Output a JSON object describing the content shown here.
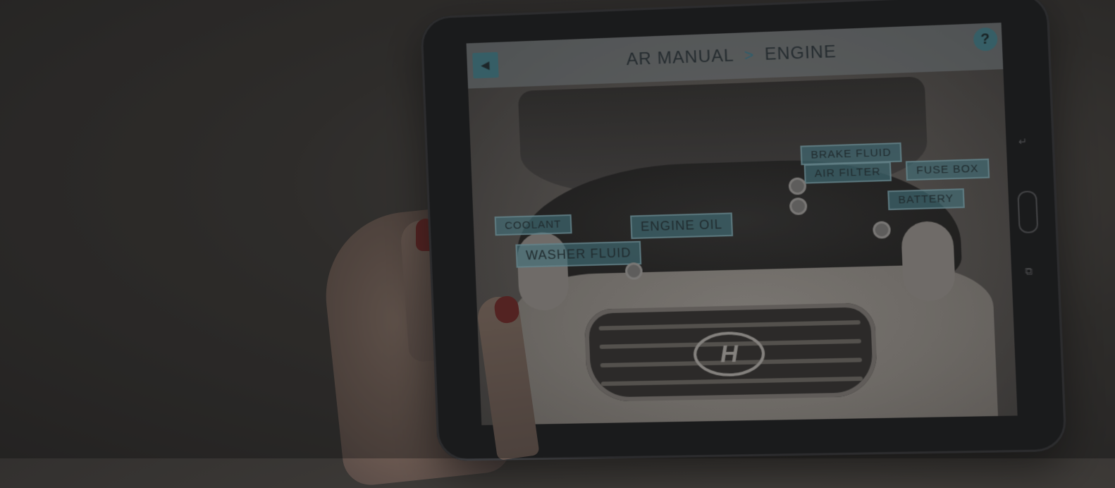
{
  "app": {
    "breadcrumb": {
      "parent": "AR MANUAL",
      "separator": ">",
      "current": "ENGINE"
    },
    "back_icon": "◀",
    "help_label": "?"
  },
  "car": {
    "emblem": "H"
  },
  "ar_labels": [
    {
      "id": "coolant",
      "text": "COOLANT"
    },
    {
      "id": "washer-fluid",
      "text": "WASHER FLUID"
    },
    {
      "id": "engine-oil",
      "text": "ENGINE OIL"
    },
    {
      "id": "brake-fluid",
      "text": "BRAKE FLUID"
    },
    {
      "id": "air-filter",
      "text": "AIR FILTER"
    },
    {
      "id": "fuse-box",
      "text": "FUSE BOX"
    },
    {
      "id": "battery",
      "text": "BATTERY"
    }
  ],
  "device_buttons": {
    "back": "↵",
    "recent": "⧉"
  }
}
